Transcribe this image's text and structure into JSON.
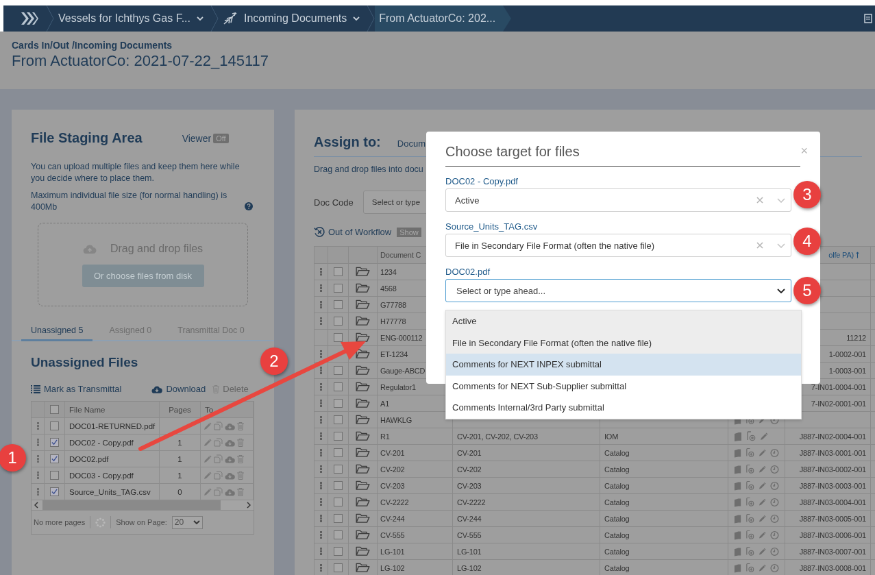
{
  "nav": {
    "crumbs": [
      {
        "kind": "menu",
        "label": "Vessels for Ichthys Gas F..."
      },
      {
        "kind": "menu_icon",
        "label": "Incoming Documents"
      },
      {
        "kind": "current",
        "label": "From ActuatorCo: 202..."
      }
    ]
  },
  "header": {
    "path": "Cards In/Out /Incoming Documents",
    "title": "From ActuatorCo: 2021-07-22_145117"
  },
  "staging": {
    "title": "File Staging Area",
    "viewer": {
      "label": "Viewer",
      "state": "Off",
      "on": false
    },
    "notes": [
      "You can upload multiple files and keep them here while you decide where to place them.",
      "Maximum individual file size (for normal handling) is 400Mb"
    ],
    "dropzone": {
      "text": "Drag and drop files",
      "button": "Or choose files from disk"
    },
    "tabs": [
      {
        "label": "Unassigned 5",
        "selected": true
      },
      {
        "label": "Assigned 0",
        "selected": false
      },
      {
        "label": "Transmittal Doc 0",
        "selected": false
      }
    ],
    "heading": "Unassigned Files",
    "actions": [
      {
        "kind": "list",
        "label": "Mark as Transmittal",
        "disabled": false
      },
      {
        "kind": "download",
        "label": "Download",
        "disabled": false
      },
      {
        "kind": "delete",
        "label": "Delete",
        "disabled": true
      }
    ],
    "table": {
      "all_checked": false,
      "columns": [
        "File Name",
        "Pages",
        "To"
      ],
      "rows": [
        {
          "name": "DOC01-RETURNED.pdf",
          "checked": false
        },
        {
          "name": "DOC02 - Copy.pdf",
          "pages": "1",
          "checked": true
        },
        {
          "name": "DOC02.pdf",
          "pages": "1",
          "checked": true
        },
        {
          "name": "DOC03 - Copy.pdf",
          "pages": "1",
          "checked": false
        },
        {
          "name": "Source_Units_TAG.csv",
          "pages": "0",
          "checked": true
        }
      ]
    },
    "footer": {
      "status": "No more pages",
      "page_size_label": "Show on Page:",
      "page_size": "20"
    }
  },
  "assign": {
    "title": "Assign to:",
    "tab": "Docum",
    "hint": "Drag and drop files into docu",
    "doc_code_label": "Doc Code",
    "doc_code_placeholder": "Select or type",
    "workflow_label": "Out of Workflow",
    "workflow_toggle": "Show"
  },
  "table": {
    "columns": [
      "Document C",
      "olfe PA)"
    ],
    "rows": [
      {
        "menu": true,
        "checked": false,
        "name": "1234"
      },
      {
        "menu": true,
        "checked": false,
        "name": "4568"
      },
      {
        "menu": true,
        "checked": false,
        "name": "G77788"
      },
      {
        "menu": true,
        "checked": false,
        "name": "H77778"
      },
      {
        "menu": false,
        "checked": false,
        "name": "ENG-000112",
        "code": "11212"
      },
      {
        "menu": true,
        "name": "ET-1234",
        "code": "1-0002-001"
      },
      {
        "menu": true,
        "checked": false,
        "name": "Gauge-ABCD",
        "code": "1-0003-001"
      },
      {
        "menu": true,
        "checked": false,
        "name": "Regulator1",
        "code": "7-IN01-0004-001"
      },
      {
        "menu": true,
        "checked": false,
        "name": "A1",
        "code": "7-IN02-0001-001"
      },
      {
        "menu": true,
        "checked": false,
        "name": "HAWKLG",
        "kind": "full"
      },
      {
        "menu": true,
        "checked": false,
        "name": "R1",
        "refs": "CV-201, CV-202, CV-203",
        "type": "IOM",
        "kind": "short",
        "code": "J887-IN02-0004-001"
      },
      {
        "menu": true,
        "checked": false,
        "name": "CV-201",
        "refs": "CV-201",
        "type": "Catalog",
        "kind": "full",
        "code": "J887-IN03-0001-001"
      },
      {
        "menu": true,
        "checked": false,
        "name": "CV-202",
        "refs": "CV-202",
        "type": "Catalog",
        "kind": "full",
        "code": "J887-IN03-0002-001"
      },
      {
        "menu": true,
        "checked": false,
        "name": "CV-203",
        "refs": "CV-203",
        "type": "Catalog",
        "kind": "full",
        "code": "J887-IN03-0003-001"
      },
      {
        "menu": true,
        "checked": false,
        "name": "CV-2222",
        "refs": "CV-2222",
        "type": "Catalog",
        "kind": "full",
        "code": "J887-IN03-0004-001"
      },
      {
        "menu": true,
        "checked": false,
        "name": "CV-244",
        "refs": "CV-244",
        "type": "Catalog",
        "kind": "full",
        "code": "J887-IN03-0005-001"
      },
      {
        "menu": true,
        "checked": false,
        "name": "CV-555",
        "refs": "CV-555",
        "type": "Catalog",
        "kind": "full",
        "code": "J887-IN03-0006-001"
      },
      {
        "menu": true,
        "checked": false,
        "name": "LG-101",
        "refs": "LG-101",
        "type": "Catalog",
        "kind": "full",
        "code": "J887-IN03-0007-001"
      },
      {
        "menu": true,
        "checked": false,
        "name": "LG-102",
        "refs": "LG-102",
        "type": "Catalog",
        "kind": "full",
        "code": "J887-IN03-0008-001"
      }
    ]
  },
  "modal": {
    "title": "Choose target for files",
    "close": "×",
    "fields": [
      {
        "label": "DOC02 - Copy.pdf",
        "value": "Active",
        "open": false
      },
      {
        "label": "Source_Units_TAG.csv",
        "value": "File in Secondary File Format (often the native file)",
        "open": false
      },
      {
        "label": "DOC02.pdf",
        "placeholder": "Select or type ahead...",
        "open": true
      }
    ],
    "options": [
      {
        "label": "Active",
        "disabled": true,
        "selected": false
      },
      {
        "label": "File in Secondary File Format (often the native file)",
        "disabled": true,
        "selected": false
      },
      {
        "label": "Comments for NEXT INPEX submittal",
        "disabled": false,
        "selected": true
      },
      {
        "label": "Comments for NEXT Sub-Supplier submittal",
        "disabled": false,
        "selected": false
      },
      {
        "label": "Comments Internal/3rd Party submittal",
        "disabled": false,
        "selected": false
      }
    ]
  },
  "annotations": [
    "1",
    "2",
    "3",
    "4",
    "5"
  ]
}
